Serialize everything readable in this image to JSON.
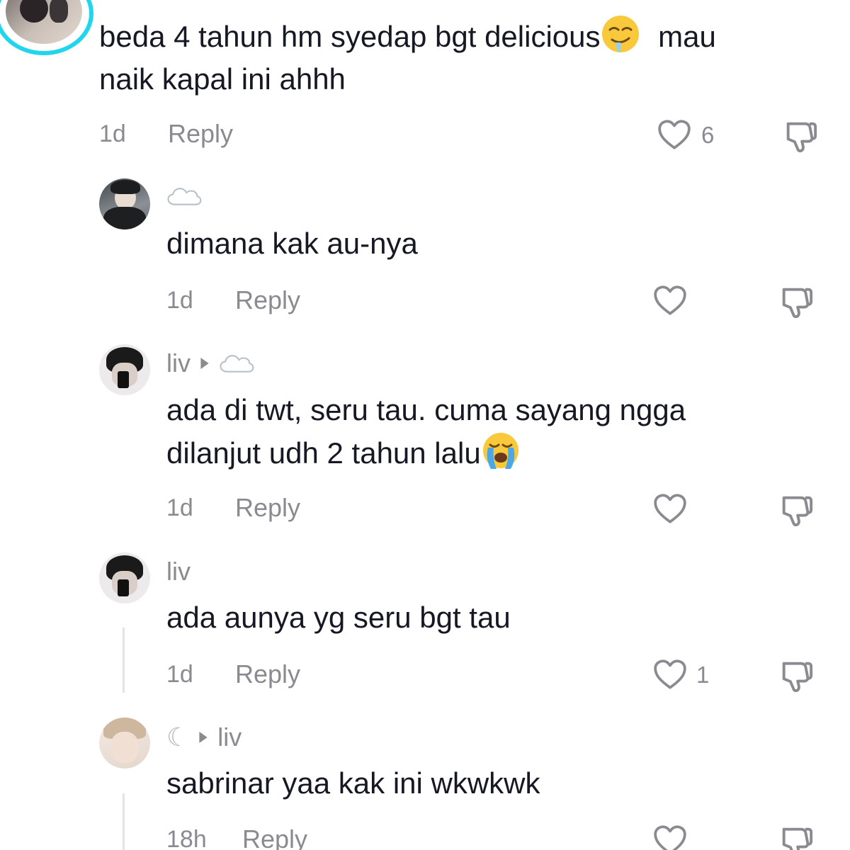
{
  "comments": [
    {
      "text_line1": "beda 4 tahun hm syedap bgt delicious",
      "text_line1_end": "mau",
      "text_line2": "naik kapal ini ahhh",
      "time": "1d",
      "reply_label": "Reply",
      "likes": "6"
    },
    {
      "username": "",
      "text": "dimana kak au-nya",
      "time": "1d",
      "reply_label": "Reply",
      "likes": ""
    },
    {
      "username": "liv",
      "text_line1": "ada di twt, seru tau. cuma sayang ngga",
      "text_line2": "dilanjut udh 2 tahun lalu",
      "time": "1d",
      "reply_label": "Reply",
      "likes": ""
    },
    {
      "username": "liv",
      "text": "ada aunya yg seru bgt tau",
      "time": "1d",
      "reply_label": "Reply",
      "likes": "1"
    },
    {
      "username_prefix": "☾",
      "username": "liv",
      "text": "sabrinar yaa kak ini wkwkwk",
      "time": "18h",
      "reply_label": "Reply"
    }
  ],
  "icons": {
    "like": "heart-outline-icon",
    "dislike": "thumbs-down-icon",
    "reply_arrow": "triangle-right-icon",
    "cloud": "cloud-emoji",
    "drool": "drooling-face-emoji",
    "cry": "loudly-crying-face-emoji"
  },
  "colors": {
    "text": "#161823",
    "muted": "#8a8b91",
    "story_ring": "#20d5ec"
  }
}
